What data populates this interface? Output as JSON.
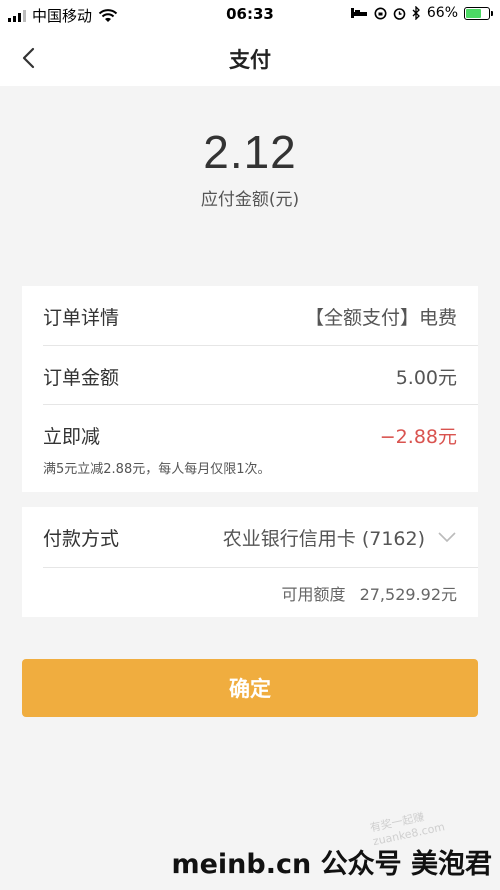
{
  "status_bar": {
    "carrier": "中国移动",
    "time": "06:33",
    "battery": "66%",
    "battery_level": 0.66
  },
  "nav": {
    "title": "支付",
    "back_icon": "chevron-left-icon"
  },
  "amount": {
    "value": "2.12",
    "label": "应付金额(元)"
  },
  "order": {
    "detail_label": "订单详情",
    "detail_value": "【全额支付】电费",
    "amount_label": "订单金额",
    "amount_value": "5.00元",
    "discount_label": "立即减",
    "discount_value": "−2.88元",
    "discount_color": "#d9534f",
    "note": "满5元立减2.88元，每人每月仅限1次。"
  },
  "payment": {
    "method_label": "付款方式",
    "method_value": "农业银行信用卡 (7162)",
    "credit_label": "可用额度",
    "credit_value": "27,529.92元"
  },
  "confirm": {
    "label": "确定",
    "color": "#f0ad3f"
  },
  "watermark": {
    "diagonal": "有奖一起赚 zuanke8.com",
    "bottom": "meinb.cn  公众号 美泡君"
  }
}
